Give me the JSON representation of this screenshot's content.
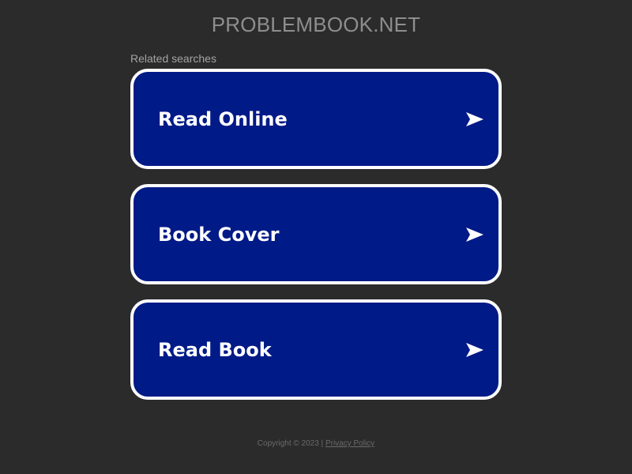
{
  "header": {
    "site_title": "PROBLEMBOOK.NET"
  },
  "related": {
    "label": "Related searches",
    "items": [
      {
        "label": "Read Online",
        "icon": "arrow-right-icon"
      },
      {
        "label": "Book Cover",
        "icon": "arrow-right-icon"
      },
      {
        "label": "Read Book",
        "icon": "arrow-right-icon"
      }
    ]
  },
  "footer": {
    "copyright": "Copyright © 2023 |",
    "privacy_link": "Privacy Policy"
  },
  "colors": {
    "background": "#2b2b2b",
    "card_fill": "#001a87",
    "card_border": "#ffffff",
    "title_text": "#8e8e8e"
  }
}
